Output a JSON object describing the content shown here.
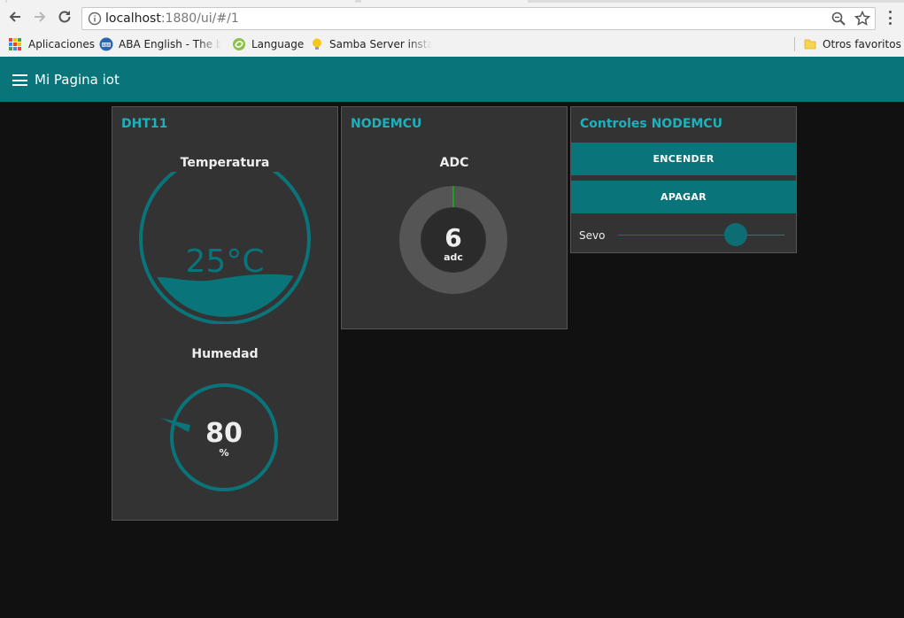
{
  "browser": {
    "url_host": "localhost",
    "url_path": ":1880/ui/#/1",
    "bookmarks": [
      {
        "label": "Aplicaciones",
        "icon": "apps-grid-icon"
      },
      {
        "label": "ABA English - The be",
        "icon": "aba-english-icon"
      },
      {
        "label": "Language",
        "icon": "language-icon"
      },
      {
        "label": "Samba Server installa",
        "icon": "lightbulb-icon"
      }
    ],
    "other_bookmarks": "Otros favoritos"
  },
  "header": {
    "title": "Mi Pagina iot",
    "color": "#097479"
  },
  "cards": {
    "dht11": {
      "title": "DHT11",
      "temperature": {
        "label": "Temperatura",
        "value": 25,
        "display": "25°C"
      },
      "humidity": {
        "label": "Humedad",
        "value": "80",
        "unit": "%"
      }
    },
    "nodemcu": {
      "title": "NODEMCU",
      "adc": {
        "label": "ADC",
        "value": "6",
        "unit": "adc"
      }
    },
    "controls": {
      "title": "Controles NODEMCU",
      "on_button": "ENCENDER",
      "off_button": "APAGAR",
      "slider_label": "Sevo",
      "slider_fraction": 0.71
    }
  },
  "colors": {
    "accent": "#097479",
    "title_text": "#1bb1bd",
    "card_bg": "#333333",
    "page_bg": "#111111",
    "gauge_track": "#555555",
    "adc_indicator": "#1e9e1e"
  }
}
